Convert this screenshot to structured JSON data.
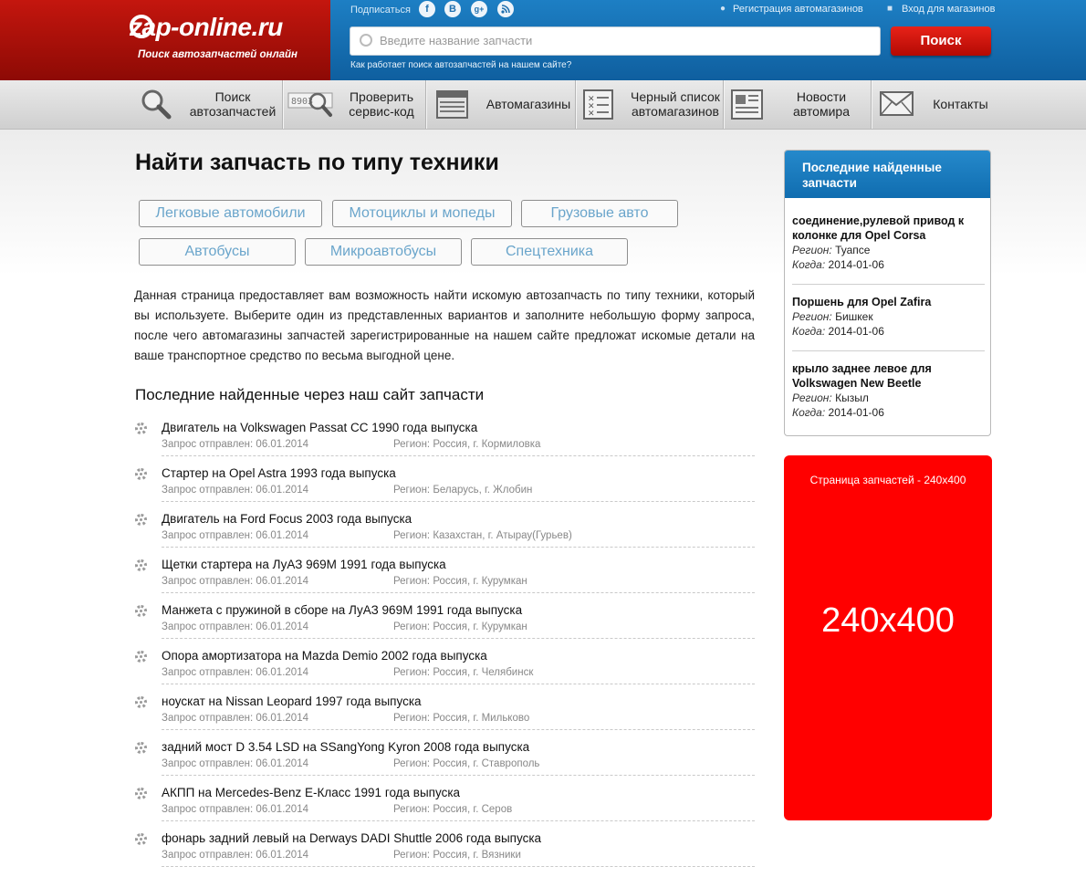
{
  "header": {
    "logo_text": "zap-online.ru",
    "logo_tagline": "Поиск автозапчастей онлайн",
    "subscribe_label": "Подписаться",
    "social": [
      "f",
      "B",
      "g+",
      "rss"
    ],
    "register_link": "Регистрация автомагазинов",
    "login_link": "Вход для магазинов",
    "search_placeholder": "Введите название запчасти",
    "search_button": "Поиск",
    "how_link": "Как работает поиск автозапчастей на нашем сайте?"
  },
  "nav": {
    "items": [
      {
        "line1": "Поиск",
        "line2": "автозапчастей",
        "icon": "magnifier-icon"
      },
      {
        "line1": "Проверить",
        "line2": "сервис-код",
        "icon": "service-code-icon"
      },
      {
        "line1": "Автомагазины",
        "line2": "",
        "icon": "shop-icon"
      },
      {
        "line1": "Черный список",
        "line2": "автомагазинов",
        "icon": "blacklist-icon"
      },
      {
        "line1": "Новости",
        "line2": "автомира",
        "icon": "news-icon"
      },
      {
        "line1": "Контакты",
        "line2": "",
        "icon": "envelope-icon"
      }
    ]
  },
  "main": {
    "title": "Найти запчасть по типу техники",
    "categories": [
      "Легковые автомобили",
      "Мотоциклы и мопеды",
      "Грузовые авто",
      "Автобусы",
      "Микроавтобусы",
      "Спецтехника"
    ],
    "description": "Данная страница предоставляет вам возможность найти искомую автозапчасть по типу техники, который вы используете. Выберите один из представленных вариантов и заполните небольшую форму запроса, после чего автомагазины запчастей зарегистрированные на нашем сайте предложат искомые детали на ваше транспортное средство по весьма выгодной цене.",
    "recent_title": "Последние найденные через наш сайт запчасти",
    "recent": [
      {
        "title": "Двигатель на Volkswagen Passat CC 1990 года выпуска",
        "date": "Запрос отправлен: 06.01.2014",
        "region": "Регион: Россия, г. Кормиловка"
      },
      {
        "title": "Стартер на Opel Astra 1993 года выпуска",
        "date": "Запрос отправлен: 06.01.2014",
        "region": "Регион: Беларусь, г. Жлобин"
      },
      {
        "title": "Двигатель на Ford Focus 2003 года выпуска",
        "date": "Запрос отправлен: 06.01.2014",
        "region": "Регион: Казахстан, г. Атырау(Гурьев)"
      },
      {
        "title": "Щетки стартера на ЛуАЗ 969М 1991 года выпуска",
        "date": "Запрос отправлен: 06.01.2014",
        "region": "Регион: Россия, г. Курумкан"
      },
      {
        "title": "Манжета с пружиной в сборе на ЛуАЗ 969М 1991 года выпуска",
        "date": "Запрос отправлен: 06.01.2014",
        "region": "Регион: Россия, г. Курумкан"
      },
      {
        "title": "Опора амортизатора на Mazda Demio 2002 года выпуска",
        "date": "Запрос отправлен: 06.01.2014",
        "region": "Регион: Россия, г. Челябинск"
      },
      {
        "title": "ноускат на Nissan Leopard 1997 года выпуска",
        "date": "Запрос отправлен: 06.01.2014",
        "region": "Регион: Россия, г. Мильково"
      },
      {
        "title": "задний мост D 3.54 LSD на SSangYong Kyron 2008 года выпуска",
        "date": "Запрос отправлен: 06.01.2014",
        "region": "Регион: Россия, г. Ставрополь"
      },
      {
        "title": "АКПП на Mercedes-Benz E-Класс 1991 года выпуска",
        "date": "Запрос отправлен: 06.01.2014",
        "region": "Регион: Россия, г. Серов"
      },
      {
        "title": "фонарь задний левый на Derways DADI Shuttle 2006 года выпуска",
        "date": "Запрос отправлен: 06.01.2014",
        "region": "Регион: Россия, г. Вязники"
      }
    ]
  },
  "sidebar": {
    "title": "Последние найденные запчасти",
    "region_label": "Регион:",
    "when_label": "Когда:",
    "items": [
      {
        "title": "соединение,рулевой привод к колонке для Opel Corsa",
        "region": "Туапсе",
        "when": "2014-01-06"
      },
      {
        "title": "Поршень для Opel Zafira",
        "region": "Бишкек",
        "when": "2014-01-06"
      },
      {
        "title": "крыло заднее левое для Volkswagen New Beetle",
        "region": "Кызыл",
        "when": "2014-01-06"
      }
    ]
  },
  "ad": {
    "caption": "Страница запчастей - 240x400",
    "size_text": "240x400",
    "color": "#ff0000"
  }
}
